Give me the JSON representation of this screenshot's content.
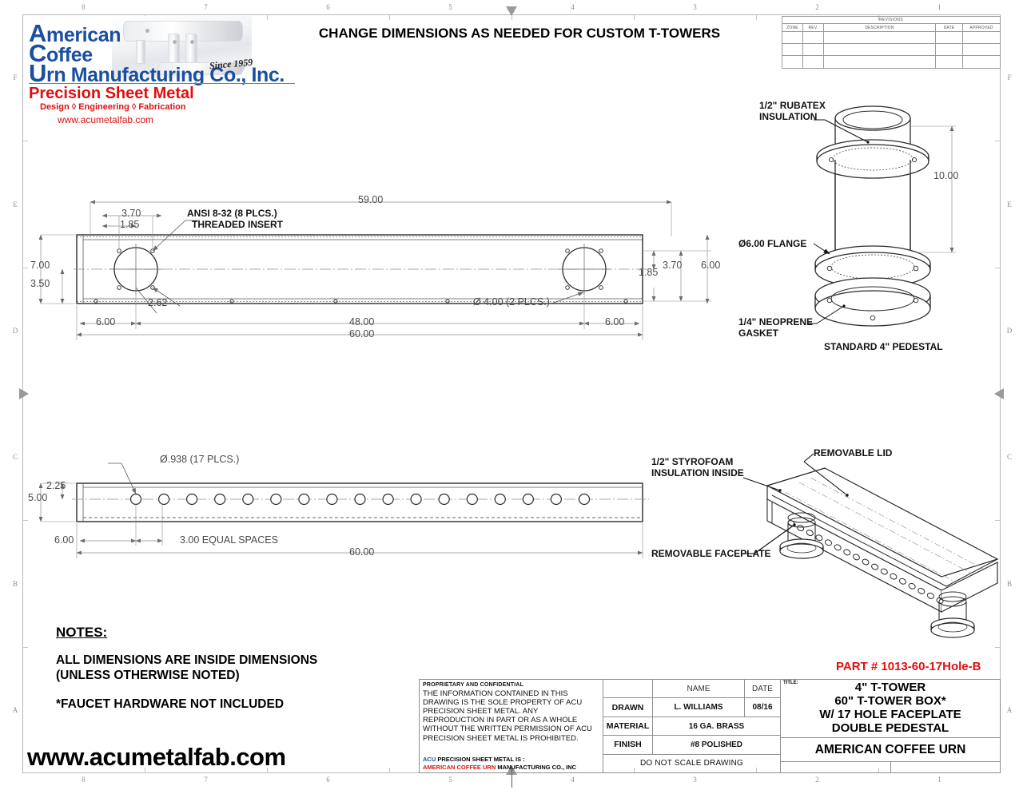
{
  "headline": "CHANGE DIMENSIONS AS NEEDED FOR CUSTOM T-TOWERS",
  "logo": {
    "line1_cap": "A",
    "line1_rest": "merican",
    "line2_cap": "C",
    "line2_rest": "offee",
    "line3_cap": "U",
    "line3_rest": "rn Manufacturing Co., Inc.",
    "since": "Since 1959",
    "precision": "Precision Sheet Metal",
    "services": "Design  ◊  Engineering  ◊  Fabrication",
    "website": "www.acumetalfab.com"
  },
  "revisions": {
    "title": "REVISIONS",
    "headers": [
      "ZONE",
      "REV.",
      "DESCRIPTION",
      "DATE",
      "APPROVED"
    ],
    "rows": [
      [
        "",
        "",
        "",
        "",
        ""
      ],
      [
        "",
        "",
        "",
        "",
        ""
      ],
      [
        "",
        "",
        "",
        "",
        ""
      ]
    ]
  },
  "border": {
    "numbers": [
      "8",
      "7",
      "6",
      "5",
      "4",
      "3",
      "2",
      "1"
    ],
    "letters": [
      "F",
      "E",
      "D",
      "C",
      "B",
      "A"
    ]
  },
  "top_view": {
    "dim_59": "59.00",
    "dim_370_left": "3.70",
    "dim_185_left": "1.85",
    "insert_note_l1": "ANSI 8-32 (8 PLCS.)",
    "insert_note_l2": "THREADED INSERT",
    "dim_700": "7.00",
    "dim_350": "3.50",
    "dim_262": "2.62",
    "dim_600_left": "6.00",
    "dim_4800": "48.00",
    "dim_6000": "60.00",
    "dim_600_right": "6.00",
    "dim_185_right": "1.85",
    "dim_370_right": "3.70",
    "dim_600_right2": "6.00",
    "hole_note": "Ø 4.00 (2 PLCS.)"
  },
  "front_view": {
    "hole_note": "Ø.938 (17 PLCS.)",
    "dim_225": "2.25",
    "dim_500": "5.00",
    "dim_600": "6.00",
    "spaces": "3.00 EQUAL SPACES",
    "dim_6000": "60.00"
  },
  "pedestal_view": {
    "rubatex_l1": "1/2\" RUBATEX",
    "rubatex_l2": "INSULATION",
    "dim_1000": "10.00",
    "flange": "Ø6.00 FLANGE",
    "gasket_l1": "1/4\" NEOPRENE",
    "gasket_l2": "GASKET",
    "pedestal": "STANDARD 4\" PEDESTAL"
  },
  "iso_view": {
    "lid": "REMOVABLE LID",
    "styro_l1": "1/2\" STYROFOAM",
    "styro_l2": "INSULATION INSIDE",
    "faceplate": "REMOVABLE FACEPLATE"
  },
  "notes": {
    "heading": "NOTES:",
    "body": "ALL DIMENSIONS ARE INSIDE DIMENSIONS\n(UNLESS OTHERWISE NOTED)",
    "extra": "*FAUCET HARDWARE NOT INCLUDED"
  },
  "footer_web": "www.acumetalfab.com",
  "part_number": "PART # 1013-60-17Hole-B",
  "title_block": {
    "proprietary_heading": "PROPRIETARY AND CONFIDENTIAL",
    "proprietary_body": "THE INFORMATION CONTAINED IN THIS DRAWING IS THE SOLE PROPERTY OF ACU PRECISION SHEET METAL.  ANY REPRODUCTION IN PART OR AS A WHOLE WITHOUT THE WRITTEN PERMISSION OF ACU PRECISION SHEET METAL IS PROHIBITED.",
    "footer_acu": "ACU",
    "footer_rest": " PRECISION SHEET METAL IS :",
    "footer_company_red": "AMERICAN COFFEE URN",
    "footer_company_rest": " MANUFACTURING CO., INC",
    "col_name": "NAME",
    "col_date": "DATE",
    "drawn_label": "DRAWN",
    "drawn_name": "L. WILLIAMS",
    "drawn_date": "08/16",
    "material_label": "MATERIAL",
    "material_value": "16 GA. BRASS",
    "finish_label": "FINISH",
    "finish_value": "#8 POLISHED",
    "do_not_scale": "DO NOT SCALE DRAWING",
    "title_label": "TITLE:",
    "title_text": "4\" T-TOWER\n60\" T-TOWER BOX*\nW/ 17 HOLE FACEPLATE\nDOUBLE PEDESTAL",
    "company": "AMERICAN COFFEE URN"
  },
  "colors": {
    "brand_blue": "#1a4fa0",
    "brand_red": "#e00f0f",
    "dim_gray": "#4a4a4a",
    "border_gray": "#b9b9b9"
  }
}
